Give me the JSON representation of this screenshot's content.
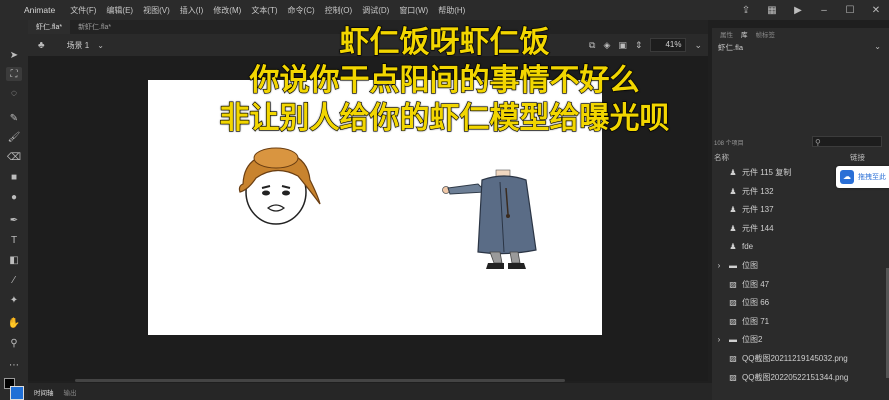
{
  "app": {
    "name": "Animate"
  },
  "menu": [
    "文件(F)",
    "编辑(E)",
    "视图(V)",
    "插入(I)",
    "修改(M)",
    "文本(T)",
    "命令(C)",
    "控制(O)",
    "调试(D)",
    "窗口(W)",
    "帮助(H)"
  ],
  "tabs": [
    {
      "label": "虾仁.fla*"
    },
    {
      "label": "新虾仁.fla*"
    }
  ],
  "scene": {
    "label": "场景 1",
    "zoom": "41%"
  },
  "timeline": {
    "tabs": [
      "时间轴",
      "输出"
    ]
  },
  "panel": {
    "tabs": [
      "属性",
      "库",
      "帧标签"
    ],
    "document": "虾仁.fla",
    "item_count": "108 个项目",
    "columns": {
      "name": "名称",
      "linkage": "链接"
    },
    "items": [
      {
        "icon": "symbol-icon",
        "label": "元件 115 复制"
      },
      {
        "icon": "symbol-icon",
        "label": "元件 132"
      },
      {
        "icon": "symbol-icon",
        "label": "元件 137"
      },
      {
        "icon": "symbol-icon",
        "label": "元件 144"
      },
      {
        "icon": "symbol-icon",
        "label": "fde"
      },
      {
        "icon": "folder-icon",
        "label": "位图",
        "expandable": true
      },
      {
        "icon": "bitmap-icon",
        "label": "位图 47"
      },
      {
        "icon": "bitmap-icon",
        "label": "位图 66"
      },
      {
        "icon": "bitmap-icon",
        "label": "位图 71"
      },
      {
        "icon": "folder-icon",
        "label": "位图2",
        "expandable": true
      },
      {
        "icon": "bitmap-icon",
        "label": "QQ截图20211219145032.png"
      },
      {
        "icon": "bitmap-icon",
        "label": "QQ截图20220522151344.png"
      }
    ]
  },
  "popup": {
    "label": "拖拽至此"
  },
  "subtitles": [
    "虾仁饭呀虾仁饭",
    "你说你干点阳间的事情不好么",
    "非让别人给你的虾仁模型给曝光呗"
  ],
  "colors": {
    "subtitle": "#f2d600",
    "stroke_swatch": "#000000",
    "fill_swatch": "#1f6fd6"
  }
}
